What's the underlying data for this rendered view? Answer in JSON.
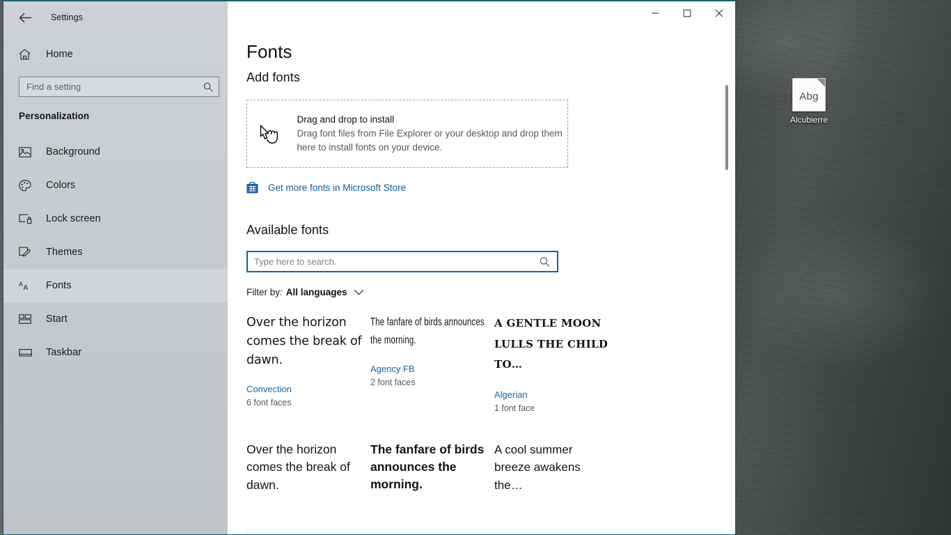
{
  "desktop": {
    "icon": {
      "name": "Alcubierre",
      "glyph_sample": "Abg"
    }
  },
  "window": {
    "title": "Settings",
    "back_icon": "back-arrow-icon",
    "caption": {
      "minimize": "─",
      "maximize": "□",
      "close": "✕"
    }
  },
  "sidebar": {
    "home": {
      "label": "Home",
      "icon": "home-icon"
    },
    "search": {
      "placeholder": "Find a setting",
      "value": "",
      "icon": "search-icon"
    },
    "category": "Personalization",
    "items": [
      {
        "label": "Background",
        "icon": "image-icon",
        "selected": false
      },
      {
        "label": "Colors",
        "icon": "palette-icon",
        "selected": false
      },
      {
        "label": "Lock screen",
        "icon": "lock-screen-icon",
        "selected": false
      },
      {
        "label": "Themes",
        "icon": "brush-icon",
        "selected": false
      },
      {
        "label": "Fonts",
        "icon": "font-aa-icon",
        "selected": true
      },
      {
        "label": "Start",
        "icon": "start-tiles-icon",
        "selected": false
      },
      {
        "label": "Taskbar",
        "icon": "taskbar-icon",
        "selected": false
      }
    ],
    "accent_color": "#0a69b9"
  },
  "main": {
    "page_title": "Fonts",
    "add_fonts_heading": "Add fonts",
    "dropzone": {
      "icon": "drag-hand-icon",
      "title": "Drag and drop to install",
      "subtitle": "Drag font files from File Explorer or your desktop and drop them here to install fonts on your device."
    },
    "store_link": {
      "icon": "microsoft-store-icon",
      "label": "Get more fonts in Microsoft Store"
    },
    "available_fonts_heading": "Available fonts",
    "font_search": {
      "placeholder": "Type here to search.",
      "value": "",
      "icon": "search-icon"
    },
    "filter": {
      "label": "Filter by:",
      "value": "All languages",
      "chevron": "chevron-down-icon"
    },
    "fonts": [
      {
        "preview": "Over the horizon comes the break of dawn.",
        "name": "Convection",
        "faces": "6 font faces",
        "style": "pv-convection"
      },
      {
        "preview": "The fanfare of birds announces the morning.",
        "name": "Agency FB",
        "faces": "2 font faces",
        "style": "pv-agency"
      },
      {
        "preview": "A gentle moon lulls the child to…",
        "name": "Algerian",
        "faces": "1 font face",
        "style": "pv-algerian"
      },
      {
        "preview": "Over the horizon comes the break of dawn.",
        "name": "",
        "faces": "",
        "style": "pv-arial"
      },
      {
        "preview": "The fanfare of birds announces the morning.",
        "name": "",
        "faces": "",
        "style": "pv-arialblk"
      },
      {
        "preview": "A cool summer breeze awakens the…",
        "name": "",
        "faces": "",
        "style": "pv-arialnar"
      }
    ]
  },
  "colors": {
    "accent": "#0a69b9",
    "link": "#1068ad",
    "window_border": "#14556a",
    "sidebar_bg": "#c8ccd0"
  }
}
